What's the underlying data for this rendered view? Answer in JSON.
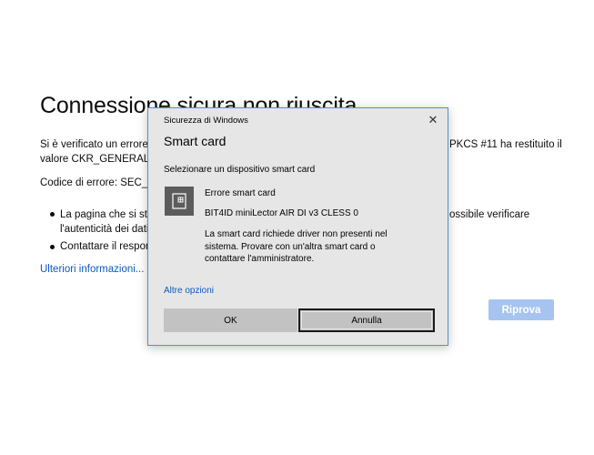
{
  "background_page": {
    "title": "Connessione sicura non riuscita",
    "paragraph_line1_left": "Si è verificato un errore d",
    "paragraph_line1_right": "PKCS #11 ha restituito il",
    "paragraph_line2": "valore CKR_GENERAL_ER",
    "error_code": "Codice di errore: SEC_ER",
    "bullets": [
      {
        "line1_left": "La pagina che si sta",
        "line1_right": "ossibile verificare",
        "line2": "l'autenticità dei dati"
      },
      {
        "line1_left": "Contattare il respon"
      }
    ],
    "more_info_link": "Ulteriori informazioni...",
    "retry_button": "Riprova"
  },
  "dialog": {
    "caption": "Sicurezza di Windows",
    "close_glyph": "✕",
    "heading": "Smart card",
    "subheading": "Selezionare un dispositivo smart card",
    "card": {
      "title": "Errore smart card",
      "name": "BIT4ID miniLector AIR DI v3 CLESS 0",
      "message": "La smart card richiede driver non presenti nel sistema. Provare con un'altra smart card o contattare l'amministratore."
    },
    "more_options_link": "Altre opzioni",
    "ok_button": "OK",
    "cancel_button": "Annulla"
  },
  "colors": {
    "link": "#0a59c5",
    "retry_button_bg": "#a6c4ef",
    "dialog_bg": "#e6e6e6",
    "dialog_border": "#5a8dc8",
    "icon_box": "#5c5c5c"
  },
  "icons": [
    "smart-card-icon",
    "close-icon"
  ]
}
